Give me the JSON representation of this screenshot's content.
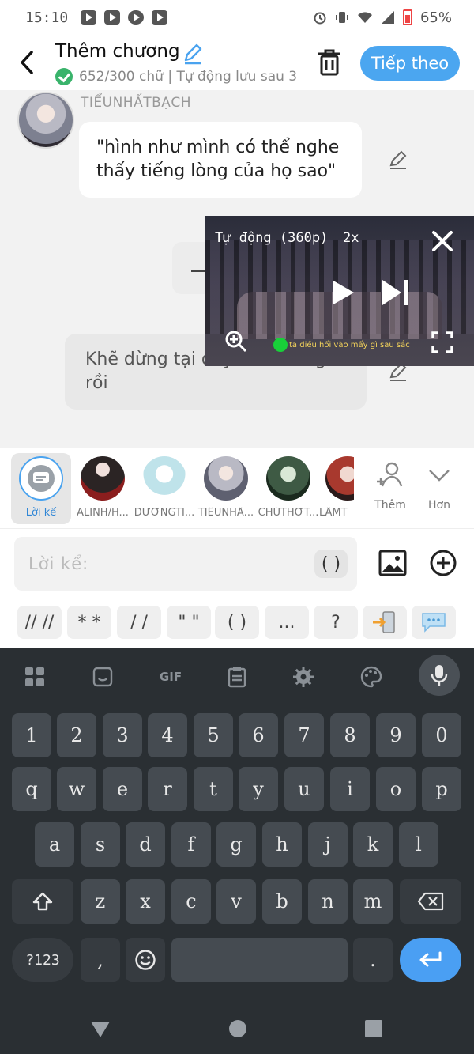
{
  "status_bar": {
    "time": "15:10",
    "battery": "65%"
  },
  "header": {
    "title": "Thêm chương",
    "subtitle": "652/300 chữ | Tự động lưu sau 3",
    "next_button": "Tiếp theo"
  },
  "chat": {
    "speaker_name": "TIỂUNHẤTBẠCH",
    "message_1": "\"hình như mình có thể nghe thấy tiếng lòng của họ sao\"",
    "message_2": "Khẽ dừng tại đây ... buổi ngủ rồi"
  },
  "video": {
    "quality": "Tự động (360p)",
    "speed": "2x",
    "subtitle": "ta điều hối vào mấy gì sau sắc"
  },
  "characters": [
    {
      "label": "Lời kể",
      "color": "#4aa3ef"
    },
    {
      "label": "ALINH/H...",
      "color": "#6b5a5a"
    },
    {
      "label": "DƯƠNGTI...",
      "color": "#bfe3ea"
    },
    {
      "label": "TIỂUNHẤ...",
      "color": "#8c8e9a"
    },
    {
      "label": "CHỦTHỚT...",
      "color": "#3e5a44"
    },
    {
      "label": "LÂMT",
      "color": "#a8392e"
    }
  ],
  "char_actions": {
    "add": "Thêm",
    "more": "Hơn"
  },
  "input": {
    "placeholder": "Lời kể:",
    "paren": "( )"
  },
  "quick_symbols": [
    "// //",
    "* *",
    "/ /",
    "\" \"",
    "( )",
    "...",
    "?"
  ],
  "keyboard": {
    "toolbar_gif": "GIF",
    "rows": [
      [
        "1",
        "2",
        "3",
        "4",
        "5",
        "6",
        "7",
        "8",
        "9",
        "0"
      ],
      [
        "q",
        "w",
        "e",
        "r",
        "t",
        "y",
        "u",
        "i",
        "o",
        "p"
      ],
      [
        "a",
        "s",
        "d",
        "f",
        "g",
        "h",
        "j",
        "k",
        "l"
      ],
      [
        "z",
        "x",
        "c",
        "v",
        "b",
        "n",
        "m"
      ]
    ],
    "sym_key": "?123",
    "comma": ",",
    "period": "."
  }
}
